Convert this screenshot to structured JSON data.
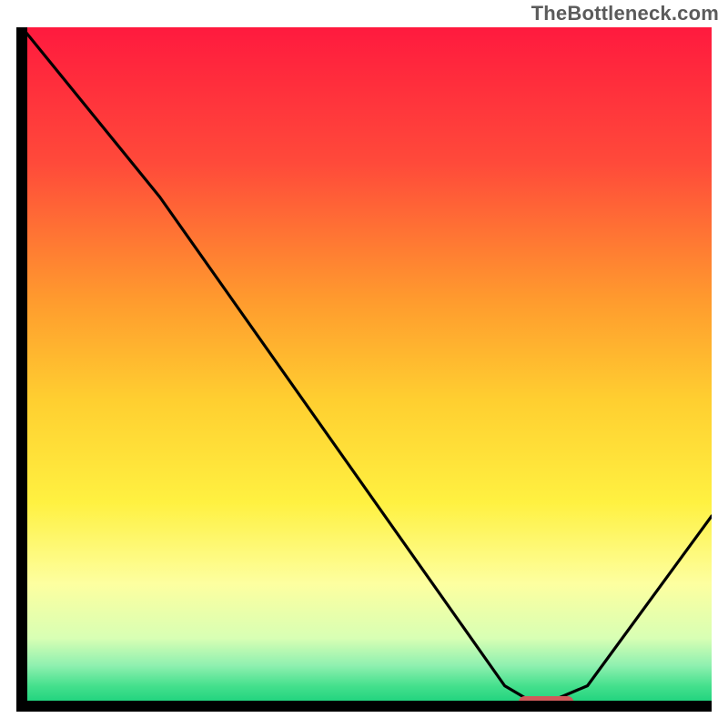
{
  "attribution": "TheBottleneck.com",
  "chart_data": {
    "type": "line",
    "title": "",
    "xlabel": "",
    "ylabel": "",
    "xlim": [
      0,
      100
    ],
    "ylim": [
      0,
      100
    ],
    "grid": false,
    "legend": false,
    "series": [
      {
        "name": "curve",
        "x": [
          0,
          20,
          70,
          75,
          82,
          100
        ],
        "y": [
          100,
          75,
          3,
          0,
          3,
          28
        ]
      }
    ],
    "marker": {
      "name": "optimal-zone",
      "x_start": 72,
      "x_end": 80,
      "y": 0,
      "color": "#d05a5a"
    },
    "background_gradient": {
      "stops": [
        {
          "pos": 0.0,
          "color": "#ff1a3e"
        },
        {
          "pos": 0.2,
          "color": "#ff4a3a"
        },
        {
          "pos": 0.4,
          "color": "#ff9a2e"
        },
        {
          "pos": 0.55,
          "color": "#ffcf30"
        },
        {
          "pos": 0.7,
          "color": "#fff141"
        },
        {
          "pos": 0.82,
          "color": "#fdffa0"
        },
        {
          "pos": 0.9,
          "color": "#d8ffb4"
        },
        {
          "pos": 0.94,
          "color": "#8ff0b0"
        },
        {
          "pos": 0.97,
          "color": "#45e08d"
        },
        {
          "pos": 1.0,
          "color": "#17d07a"
        }
      ]
    },
    "axes_color": "#000000"
  }
}
